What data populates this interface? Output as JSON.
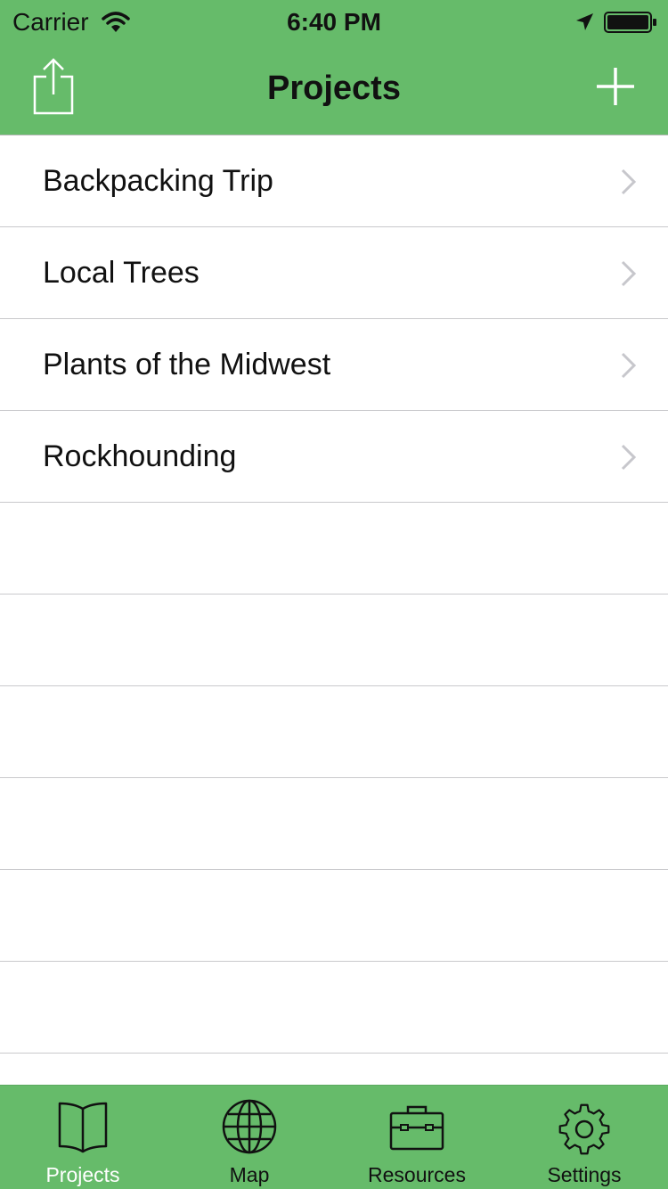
{
  "status_bar": {
    "carrier": "Carrier",
    "time": "6:40 PM",
    "icons": [
      "wifi-icon",
      "location-arrow-icon",
      "battery-icon"
    ]
  },
  "nav": {
    "title": "Projects",
    "left_icon": "share-icon",
    "right_icon": "plus-icon"
  },
  "projects": [
    {
      "label": "Backpacking Trip"
    },
    {
      "label": "Local Trees"
    },
    {
      "label": "Plants of the Midwest"
    },
    {
      "label": "Rockhounding"
    }
  ],
  "tabs": [
    {
      "label": "Projects",
      "icon": "book-icon",
      "active": true
    },
    {
      "label": "Map",
      "icon": "globe-icon",
      "active": false
    },
    {
      "label": "Resources",
      "icon": "briefcase-icon",
      "active": false
    },
    {
      "label": "Settings",
      "icon": "gear-icon",
      "active": false
    }
  ],
  "colors": {
    "accent": "#66bb6a",
    "active_tab_label": "#ffffff",
    "separator": "#c9c9cc",
    "chevron": "#c7c7cc"
  }
}
